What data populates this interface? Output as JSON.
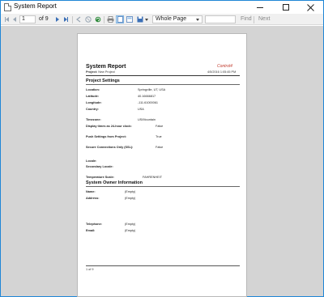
{
  "window": {
    "title": "System Report"
  },
  "toolbar": {
    "page_current": "1",
    "page_of": "of 9",
    "zoom": "Whole Page",
    "find_value": "",
    "find_label": "Find",
    "next_label": "Next"
  },
  "report": {
    "title": "System Report",
    "project_label": "Project:",
    "project_value": "New Project",
    "logo_text": "Control4",
    "date": "4/5/2016 1:05:45 PM",
    "project_settings_heading": "Project Settings",
    "location": {
      "label": "Location:",
      "value": "Springville, UT, USA"
    },
    "latitude": {
      "label": "Latitude:",
      "value": "40.16666817"
    },
    "longitude": {
      "label": "Longitude:",
      "value": "-111.61000061"
    },
    "country": {
      "label": "Country:",
      "value": "USA"
    },
    "timezone": {
      "label": "Timezone:",
      "value": "US/Mountain"
    },
    "display24": {
      "label": "Display times as 24-hour clock:",
      "value": "False"
    },
    "push": {
      "label": "Push Settings from Project:",
      "value": "True"
    },
    "secure": {
      "label": "Secure Connections Only (SSL):",
      "value": "False"
    },
    "locale": {
      "label": "Locale:",
      "value": ""
    },
    "secondary_locale": {
      "label": "Secondary Locale:",
      "value": ""
    },
    "temp": {
      "label": "Temperature Scale:",
      "value": "FAHRENHEIT"
    },
    "owner_heading": "System Owner Information",
    "name": {
      "label": "Name:",
      "value": "(Empty)"
    },
    "address": {
      "label": "Address:",
      "value": "(Empty)"
    },
    "telephone": {
      "label": "Telephone:",
      "value": "(Empty)"
    },
    "email": {
      "label": "Email:",
      "value": "(Empty)"
    },
    "footer": "1 of 9"
  }
}
